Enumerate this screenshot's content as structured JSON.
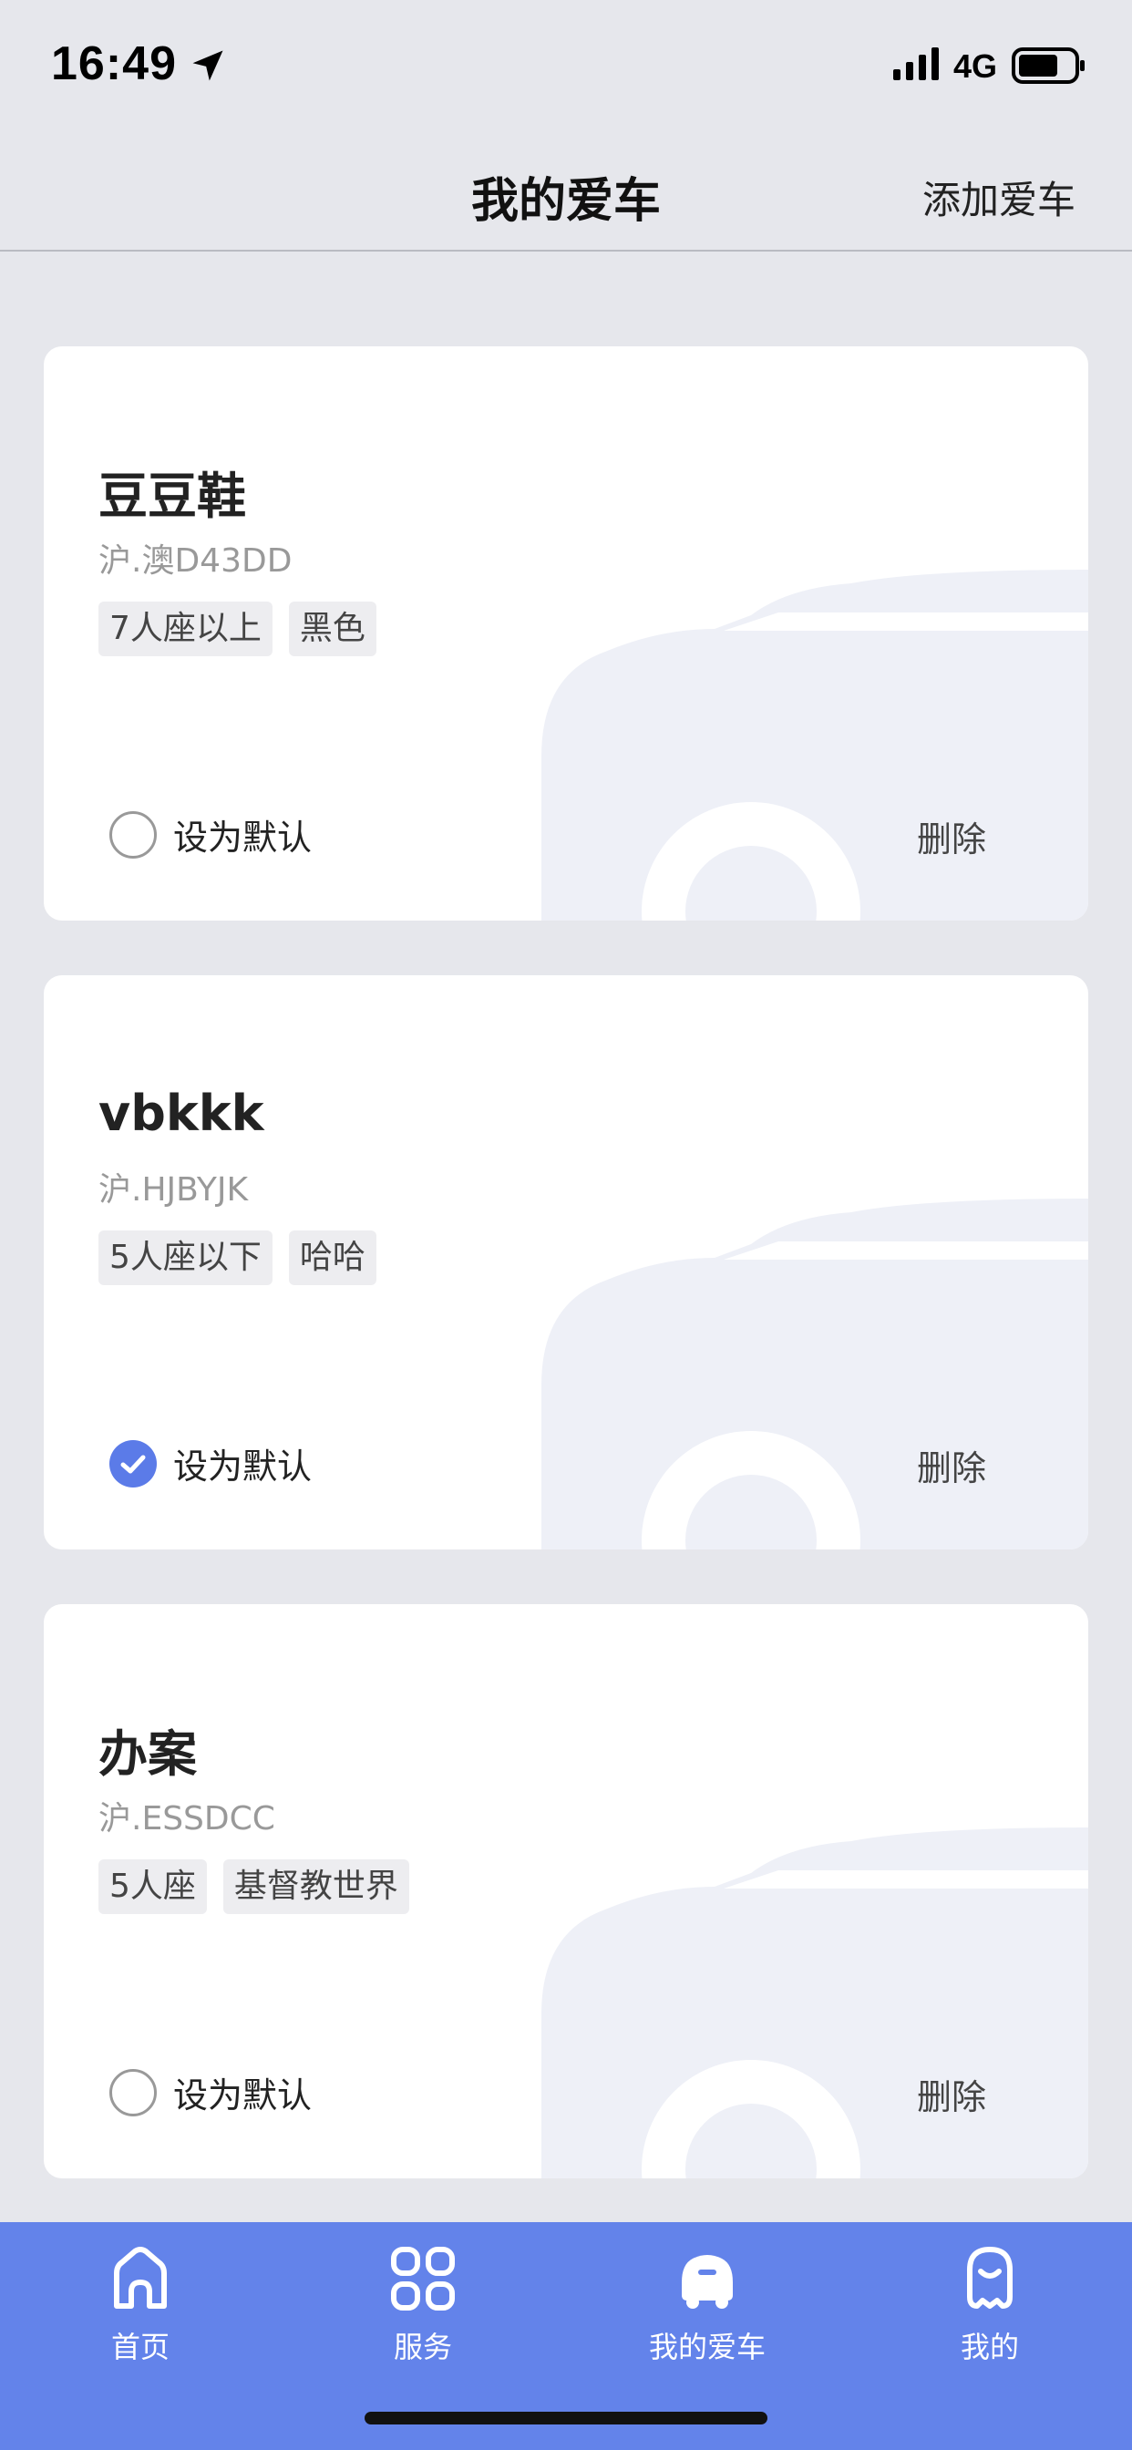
{
  "status_bar": {
    "time": "16:49",
    "network": "4G",
    "icons": [
      "location-arrow-icon",
      "cellular-signal-icon",
      "battery-icon"
    ]
  },
  "header": {
    "title": "我的爱车",
    "action": "添加爱车"
  },
  "cars": [
    {
      "name": "豆豆鞋",
      "plate": "沪.澳D43DD",
      "tags": [
        "7人座以上",
        "黑色"
      ],
      "default_label": "设为默认",
      "is_default": false,
      "delete_label": "删除"
    },
    {
      "name": "vbkkk",
      "plate": "沪.HJBYJK",
      "tags": [
        "5人座以下",
        "哈哈"
      ],
      "default_label": "设为默认",
      "is_default": true,
      "delete_label": "删除"
    },
    {
      "name": "办案",
      "plate": "沪.ESSDCC",
      "tags": [
        "5人座",
        "基督教世界"
      ],
      "default_label": "设为默认",
      "is_default": false,
      "delete_label": "删除"
    }
  ],
  "tab_bar": {
    "tabs": [
      {
        "label": "首页",
        "icon": "home-icon"
      },
      {
        "label": "服务",
        "icon": "services-grid-icon"
      },
      {
        "label": "我的爱车",
        "icon": "car-icon",
        "active": true
      },
      {
        "label": "我的",
        "icon": "profile-icon"
      }
    ]
  },
  "colors": {
    "accent": "#6383ea",
    "checked_radio": "#5b7be8",
    "background": "#e6e7ec",
    "card": "#ffffff",
    "muted_text": "#999999"
  }
}
